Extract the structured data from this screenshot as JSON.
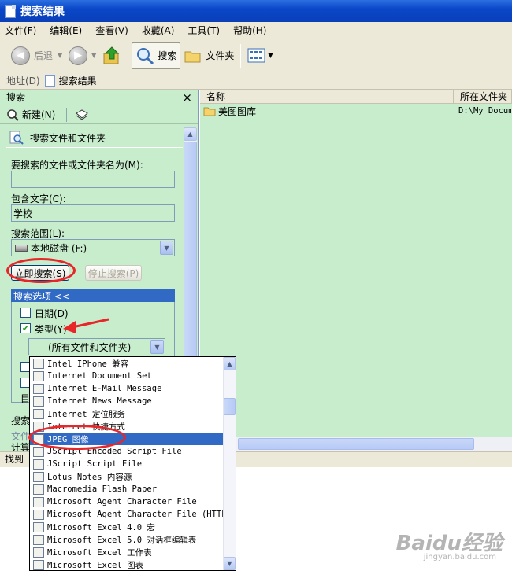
{
  "window": {
    "title": "搜索结果"
  },
  "menu": [
    "文件(F)",
    "编辑(E)",
    "查看(V)",
    "收藏(A)",
    "工具(T)",
    "帮助(H)"
  ],
  "toolbar": {
    "back": "后退",
    "search": "搜索",
    "folders": "文件夹"
  },
  "address": {
    "label": "地址(D)",
    "value": "搜索结果"
  },
  "search_pane": {
    "title": "搜索",
    "close": "×",
    "new_label": "新建(N)",
    "section_title": "搜索文件和文件夹",
    "name_label": "要搜索的文件或文件夹名为(M):",
    "name_value": "",
    "contains_label": "包含文字(C):",
    "contains_value": "学校",
    "look_in_label": "搜索范围(L):",
    "look_in_value": "本地磁盘 (F:)",
    "search_now": "立即搜索(S)",
    "stop_search": "停止搜索(P)",
    "options_header": "搜索选项 <<",
    "date_label": "日期(D)",
    "type_label": "类型(Y)",
    "type_checked": true,
    "type_value": "(所有文件和文件夹)",
    "more_label_1": "目",
    "more_label_2": "搜索",
    "more_label_3": "文件",
    "more_label_4": "计算"
  },
  "results": {
    "columns": [
      "名称",
      "所在文件夹"
    ],
    "rows": [
      {
        "name": "美图图库",
        "folder": "D:\\My Docume"
      }
    ]
  },
  "status": "找到",
  "dropdown_items": [
    "Intel IPhone 兼容",
    "Internet Document Set",
    "Internet E-Mail Message",
    "Internet News Message",
    "Internet 定位服务",
    "Internet 快捷方式",
    "JPEG 图像",
    "JScript Encoded Script File",
    "JScript Script File",
    "Lotus Notes 内容源",
    "Macromedia Flash Paper",
    "Microsoft Agent Character File",
    "Microsoft Agent Character File (HTTP",
    "Microsoft Excel 4.0 宏",
    "Microsoft Excel 5.0 对话框编辑表",
    "Microsoft Excel 工作表",
    "Microsoft Excel 图表"
  ],
  "selected_dropdown_index": 6,
  "watermark": {
    "logo": "Baidu经验",
    "url": "jingyan.baidu.com"
  },
  "colors": {
    "pane_bg": "#c7edcc",
    "highlight": "#316ac5",
    "annotation": "#e8262a",
    "titlebar": "#0a47c8"
  }
}
